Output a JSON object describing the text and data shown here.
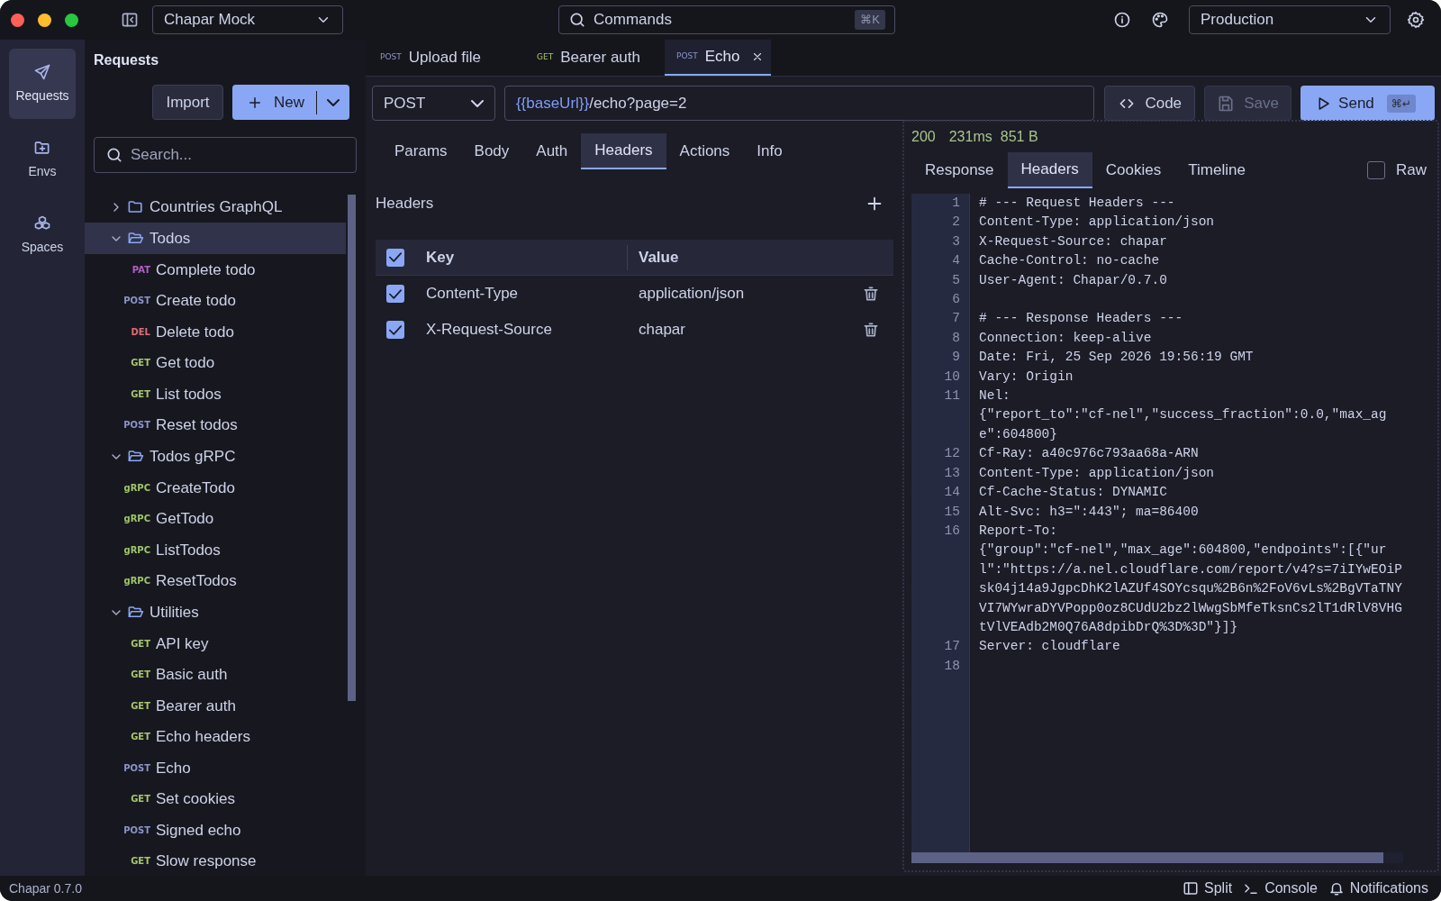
{
  "title_bar": {
    "workspace": "Chapar Mock",
    "commands": {
      "placeholder": "Commands",
      "shortcut": "⌘K"
    },
    "environment": "Production"
  },
  "rail": [
    {
      "kind": "requests",
      "label": "Requests",
      "selected": true
    },
    {
      "kind": "envs",
      "label": "Envs",
      "selected": false
    },
    {
      "kind": "spaces",
      "label": "Spaces",
      "selected": false
    }
  ],
  "sidebar": {
    "title": "Requests",
    "import": "Import",
    "new": "New",
    "search": {
      "placeholder": "Search..."
    },
    "tree": [
      {
        "name": "Countries GraphQL",
        "expanded": false,
        "selected": false
      },
      {
        "name": "Todos",
        "expanded": true,
        "selected": true,
        "children": [
          {
            "method": "PAT",
            "color": "#b35fc4",
            "name": "Complete todo",
            "selected": false
          },
          {
            "method": "POST",
            "color": "#8c93c9",
            "name": "Create todo",
            "selected": false
          },
          {
            "method": "DEL",
            "color": "#e06c75",
            "name": "Delete todo",
            "selected": false
          },
          {
            "method": "GET",
            "color": "#a9c56d",
            "name": "Get todo",
            "selected": false
          },
          {
            "method": "GET",
            "color": "#a9c56d",
            "name": "List todos",
            "selected": false
          },
          {
            "method": "POST",
            "color": "#8c93c9",
            "name": "Reset todos",
            "selected": false
          }
        ]
      },
      {
        "name": "Todos gRPC",
        "expanded": true,
        "selected": false,
        "children": [
          {
            "method": "gRPC",
            "color": "#9fc46a",
            "name": "CreateTodo",
            "selected": false
          },
          {
            "method": "gRPC",
            "color": "#9fc46a",
            "name": "GetTodo",
            "selected": false
          },
          {
            "method": "gRPC",
            "color": "#9fc46a",
            "name": "ListTodos",
            "selected": false
          },
          {
            "method": "gRPC",
            "color": "#9fc46a",
            "name": "ResetTodos",
            "selected": false
          }
        ]
      },
      {
        "name": "Utilities",
        "expanded": true,
        "selected": false,
        "children": [
          {
            "method": "GET",
            "color": "#a9c56d",
            "name": "API key",
            "selected": false
          },
          {
            "method": "GET",
            "color": "#a9c56d",
            "name": "Basic auth",
            "selected": false
          },
          {
            "method": "GET",
            "color": "#a9c56d",
            "name": "Bearer auth",
            "selected": false
          },
          {
            "method": "GET",
            "color": "#a9c56d",
            "name": "Echo headers",
            "selected": false
          },
          {
            "method": "POST",
            "color": "#8c93c9",
            "name": "Echo",
            "selected": false
          },
          {
            "method": "GET",
            "color": "#a9c56d",
            "name": "Set cookies",
            "selected": false
          },
          {
            "method": "POST",
            "color": "#8c93c9",
            "name": "Signed echo",
            "selected": false
          },
          {
            "method": "GET",
            "color": "#a9c56d",
            "name": "Slow response",
            "selected": false
          }
        ]
      }
    ]
  },
  "tabs": [
    {
      "method": "POST",
      "color": "#8c93c9",
      "label": "Upload file",
      "selected": false
    },
    {
      "method": "GET",
      "color": "#a9c56d",
      "label": "Bearer auth",
      "selected": false
    },
    {
      "method": "POST",
      "color": "#8c93c9",
      "label": "Echo",
      "selected": true
    }
  ],
  "request": {
    "method": "POST",
    "url": {
      "variable": "{{baseUrl}}",
      "path": "/echo?page=2"
    },
    "code": "Code",
    "save": {
      "label": "Save",
      "disabled": true
    },
    "send": {
      "label": "Send",
      "shortcut": "⌘↵"
    }
  },
  "request_tabs": [
    {
      "label": "Params",
      "selected": false
    },
    {
      "label": "Body",
      "selected": false
    },
    {
      "label": "Auth",
      "selected": false
    },
    {
      "label": "Headers",
      "selected": true
    },
    {
      "label": "Actions",
      "selected": false
    },
    {
      "label": "Info",
      "selected": false
    }
  ],
  "headers": {
    "title": "Headers",
    "columns": [
      "Key",
      "Value"
    ],
    "all_checked": true,
    "rows": [
      {
        "key": "Content-Type",
        "value": "application/json",
        "checked": true
      },
      {
        "key": "X-Request-Source",
        "value": "chapar",
        "checked": true
      }
    ]
  },
  "response": {
    "status": "200",
    "time": "231ms",
    "size": "851 B",
    "tabs": [
      {
        "label": "Response",
        "selected": false
      },
      {
        "label": "Headers",
        "selected": true
      },
      {
        "label": "Cookies",
        "selected": false
      },
      {
        "label": "Timeline",
        "selected": false
      }
    ],
    "raw": {
      "label": "Raw",
      "checked": false
    },
    "lines": [
      {
        "n": "1",
        "text": "# --- Request Headers ---"
      },
      {
        "n": "2",
        "text": "Content-Type: application/json"
      },
      {
        "n": "3",
        "text": "X-Request-Source: chapar"
      },
      {
        "n": "4",
        "text": "Cache-Control: no-cache"
      },
      {
        "n": "5",
        "text": "User-Agent: Chapar/0.7.0"
      },
      {
        "n": "6"
      },
      {
        "n": "7",
        "text": "# --- Response Headers ---"
      },
      {
        "n": "8",
        "text": "Connection: keep-alive"
      },
      {
        "n": "9",
        "text": "Date: Fri, 25 Sep 2026 19:56:19 GMT"
      },
      {
        "n": "10",
        "text": "Vary: Origin"
      },
      {
        "n": "11",
        "text": "Nel: {\"report_to\":\"cf-nel\",\"success_fraction\":0.0,\"max_age\":604800}"
      },
      {
        "n": "12",
        "text": "Cf-Ray: a40c976c793aa68a-ARN"
      },
      {
        "n": "13",
        "text": "Content-Type: application/json"
      },
      {
        "n": "14",
        "text": "Cf-Cache-Status: DYNAMIC"
      },
      {
        "n": "15",
        "text": "Alt-Svc: h3=\":443\"; ma=86400"
      },
      {
        "n": "16",
        "text": "Report-To: {\"group\":\"cf-nel\",\"max_age\":604800,\"endpoints\":[{\"url\":\"https://a.nel.cloudflare.com/report/v4?s=7iIYwEOiPsk04j14a9JgpcDhK2lAZUf4SOYcsqu%2B6n%2FoV6vLs%2BgVTaTNYVI7WYwraDYVPopp0oz8CUdU2bz2lWwgSbMfeTksnCs2lT1dRlV8VHGtVlVEAdb2M0Q76A8dpibDrQ%3D%3D\"}]}"
      },
      {
        "n": "17",
        "text": "Server: cloudflare"
      },
      {
        "n": "18"
      }
    ]
  },
  "status_bar": {
    "version": "Chapar 0.7.0",
    "items": [
      {
        "kind": "split",
        "label": "Split"
      },
      {
        "kind": "console",
        "label": "Console"
      },
      {
        "kind": "notifications",
        "label": "Notifications"
      }
    ]
  }
}
